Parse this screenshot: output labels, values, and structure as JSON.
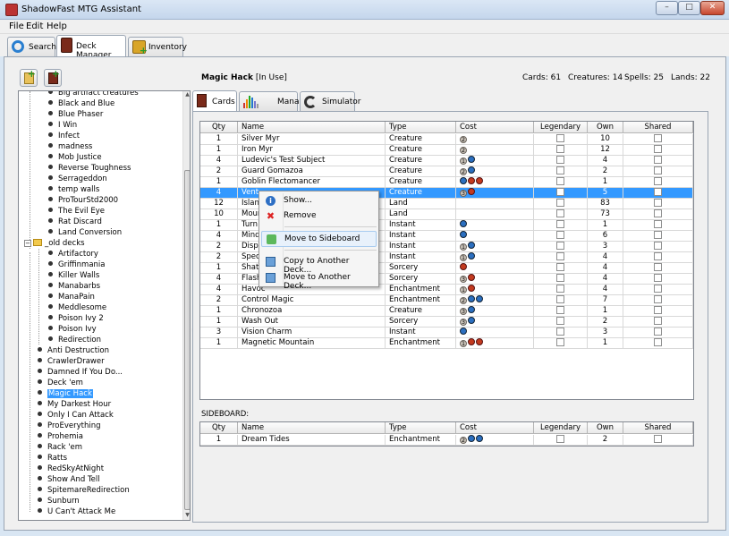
{
  "window": {
    "title": "ShadowFast MTG Assistant"
  },
  "menu": [
    "File",
    "Edit",
    "Help"
  ],
  "main_tabs": [
    {
      "label": "Search",
      "icon": "search-icon"
    },
    {
      "label": "Deck Manager",
      "icon": "deck-icon",
      "active": true
    },
    {
      "label": "Inventory",
      "icon": "inventory-icon"
    }
  ],
  "toolbar": {
    "new_folder_icon": "new-folder-icon",
    "new_deck_icon": "new-deck-icon"
  },
  "tree": {
    "items_top": [
      "Big artifact creatures",
      "Black and Blue",
      "Blue Phaser",
      "I Win",
      "Infect",
      "madness",
      "Mob Justice",
      "Reverse Toughness",
      "Serrageddon",
      "temp walls",
      "ProTourStd2000",
      "The Evil Eye",
      "Rat Discard",
      "Land Conversion"
    ],
    "folder": "_old decks",
    "folder_items": [
      "Artifactory",
      "Griffinmania",
      "Killer Walls",
      "Manabarbs",
      "ManaPain",
      "Meddlesome",
      "Poison Ivy 2",
      "Poison Ivy",
      "Redirection"
    ],
    "root_items": [
      "Anti Destruction",
      "CrawlerDrawer",
      "Damned If You Do...",
      "Deck 'em",
      "Magic Hack",
      "My Darkest Hour",
      "Only I Can Attack",
      "ProEverything",
      "Prohemia",
      "Rack 'em",
      "Ratts",
      "RedSkyAtNight",
      "Show And Tell",
      "SpitemareRedirection",
      "Sunburn",
      "U Can't Attack Me"
    ],
    "selected": "Magic Hack"
  },
  "deck": {
    "name": "Magic Hack",
    "status": "[In Use]"
  },
  "stats": {
    "cards": "Cards: 61",
    "creatures": "Creatures: 14",
    "spells": "Spells: 25",
    "lands": "Lands: 22"
  },
  "sub_tabs": [
    {
      "label": "Cards",
      "active": true
    },
    {
      "label": "Mana"
    },
    {
      "label": "Simulator"
    }
  ],
  "columns": [
    "Qty",
    "Name",
    "Type",
    "Cost",
    "Legendary",
    "Own",
    "Shared"
  ],
  "rows": [
    {
      "qty": "1",
      "name": "Silver Myr",
      "type": "Creature",
      "cost": [
        {
          "k": "gen",
          "t": "2"
        }
      ],
      "own": "10"
    },
    {
      "qty": "1",
      "name": "Iron Myr",
      "type": "Creature",
      "cost": [
        {
          "k": "gen",
          "t": "2"
        }
      ],
      "own": "12"
    },
    {
      "qty": "4",
      "name": "Ludevic's Test Subject",
      "type": "Creature",
      "cost": [
        {
          "k": "gen",
          "t": "1"
        },
        {
          "k": "blu",
          "t": ""
        }
      ],
      "own": "4"
    },
    {
      "qty": "2",
      "name": "Guard Gomazoa",
      "type": "Creature",
      "cost": [
        {
          "k": "gen",
          "t": "2"
        },
        {
          "k": "blu",
          "t": ""
        }
      ],
      "own": "2"
    },
    {
      "qty": "1",
      "name": "Goblin Flectomancer",
      "type": "Creature",
      "cost": [
        {
          "k": "blu",
          "t": ""
        },
        {
          "k": "red",
          "t": ""
        },
        {
          "k": "red",
          "t": ""
        }
      ],
      "own": "1"
    },
    {
      "qty": "4",
      "name": "Vent",
      "type": "Creature",
      "cost": [
        {
          "k": "gen",
          "t": "3"
        },
        {
          "k": "red",
          "t": ""
        }
      ],
      "own": "5",
      "selected": true
    },
    {
      "qty": "12",
      "name": "Islan",
      "type": "Land",
      "cost": [],
      "own": "83"
    },
    {
      "qty": "10",
      "name": "Moun",
      "type": "Land",
      "cost": [],
      "own": "73"
    },
    {
      "qty": "1",
      "name": "Turn",
      "type": "Instant",
      "cost": [
        {
          "k": "blu",
          "t": ""
        }
      ],
      "own": "1"
    },
    {
      "qty": "4",
      "name": "Mind",
      "type": "Instant",
      "cost": [
        {
          "k": "blu",
          "t": ""
        }
      ],
      "own": "6"
    },
    {
      "qty": "2",
      "name": "Dispe",
      "type": "Instant",
      "cost": [
        {
          "k": "gen",
          "t": "1"
        },
        {
          "k": "blu",
          "t": ""
        }
      ],
      "own": "3"
    },
    {
      "qty": "2",
      "name": "Spec",
      "type": "Instant",
      "cost": [
        {
          "k": "gen",
          "t": "1"
        },
        {
          "k": "blu",
          "t": ""
        }
      ],
      "own": "4"
    },
    {
      "qty": "1",
      "name": "Shatt",
      "type": "Sorcery",
      "cost": [
        {
          "k": "red",
          "t": ""
        }
      ],
      "own": "4"
    },
    {
      "qty": "4",
      "name": "Flash",
      "type": "Sorcery",
      "cost": [
        {
          "k": "gen",
          "t": "3"
        },
        {
          "k": "red",
          "t": ""
        }
      ],
      "own": "4"
    },
    {
      "qty": "4",
      "name": "Havoc",
      "type": "Enchantment",
      "cost": [
        {
          "k": "gen",
          "t": "1"
        },
        {
          "k": "red",
          "t": ""
        }
      ],
      "own": "4"
    },
    {
      "qty": "2",
      "name": "Control Magic",
      "type": "Enchantment",
      "cost": [
        {
          "k": "gen",
          "t": "2"
        },
        {
          "k": "blu",
          "t": ""
        },
        {
          "k": "blu",
          "t": ""
        }
      ],
      "own": "7"
    },
    {
      "qty": "1",
      "name": "Chronozoa",
      "type": "Creature",
      "cost": [
        {
          "k": "gen",
          "t": "3"
        },
        {
          "k": "blu",
          "t": ""
        }
      ],
      "own": "1"
    },
    {
      "qty": "1",
      "name": "Wash Out",
      "type": "Sorcery",
      "cost": [
        {
          "k": "gen",
          "t": "3"
        },
        {
          "k": "blu",
          "t": ""
        }
      ],
      "own": "2"
    },
    {
      "qty": "3",
      "name": "Vision Charm",
      "type": "Instant",
      "cost": [
        {
          "k": "blu",
          "t": ""
        }
      ],
      "own": "3"
    },
    {
      "qty": "1",
      "name": "Magnetic Mountain",
      "type": "Enchantment",
      "cost": [
        {
          "k": "gen",
          "t": "1"
        },
        {
          "k": "red",
          "t": ""
        },
        {
          "k": "red",
          "t": ""
        }
      ],
      "own": "1"
    }
  ],
  "sideboard": {
    "label": "SIDEBOARD:",
    "rows": [
      {
        "qty": "1",
        "name": "Dream Tides",
        "type": "Enchantment",
        "cost": [
          {
            "k": "gen",
            "t": "2"
          },
          {
            "k": "blu",
            "t": ""
          },
          {
            "k": "blu",
            "t": ""
          }
        ],
        "own": "2"
      }
    ]
  },
  "context_menu": [
    {
      "label": "Show...",
      "icon": "info-icon"
    },
    {
      "label": "Remove",
      "icon": "remove-icon"
    },
    {
      "label": "Move to Sideboard",
      "icon": "move-down-icon",
      "highlighted": true
    },
    {
      "label": "Copy to Another Deck...",
      "icon": "copy-icon"
    },
    {
      "label": "Move to Another Deck...",
      "icon": "move-icon"
    }
  ],
  "colors": {
    "selection": "#3399ff",
    "blue_mana": "#2b6fc0",
    "red_mana": "#c33a1f"
  }
}
